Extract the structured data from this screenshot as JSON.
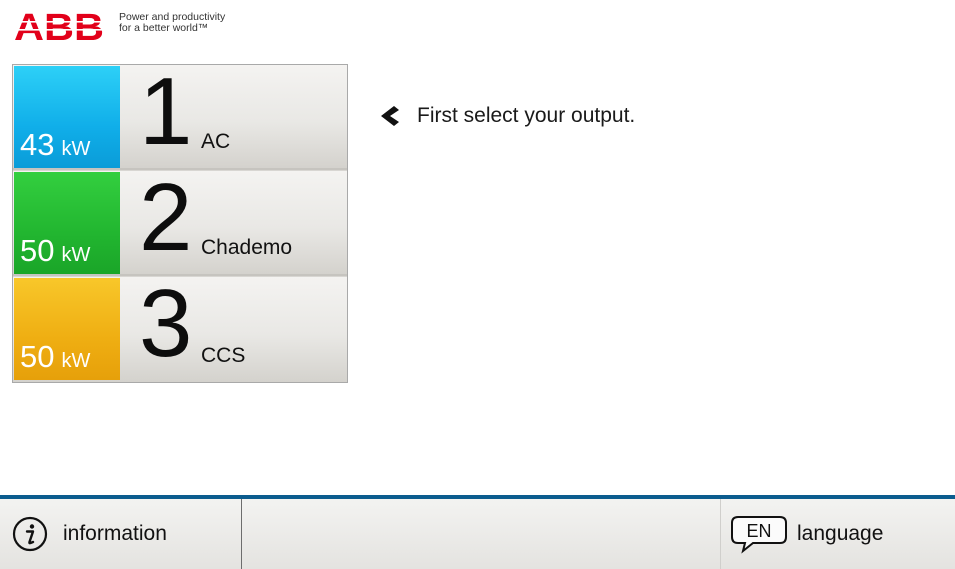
{
  "header": {
    "logo_text": "ABB",
    "tagline_line1": "Power and productivity",
    "tagline_line2": "for a better world™"
  },
  "outputs": [
    {
      "number": "1",
      "power_value": "43",
      "power_unit": "kW",
      "type": "AC",
      "color": "#10aee9"
    },
    {
      "number": "2",
      "power_value": "50",
      "power_unit": "kW",
      "type": "Chademo",
      "color": "#22b630"
    },
    {
      "number": "3",
      "power_value": "50",
      "power_unit": "kW",
      "type": "CCS",
      "color": "#efae12"
    }
  ],
  "prompt": {
    "icon": "chevron-left-icon",
    "text": "First select your output."
  },
  "footer": {
    "accent_color": "#0b5c8e",
    "info": {
      "icon": "info-icon",
      "label": "information"
    },
    "language": {
      "icon": "speech-bubble-icon",
      "code": "EN",
      "label": "language"
    }
  }
}
